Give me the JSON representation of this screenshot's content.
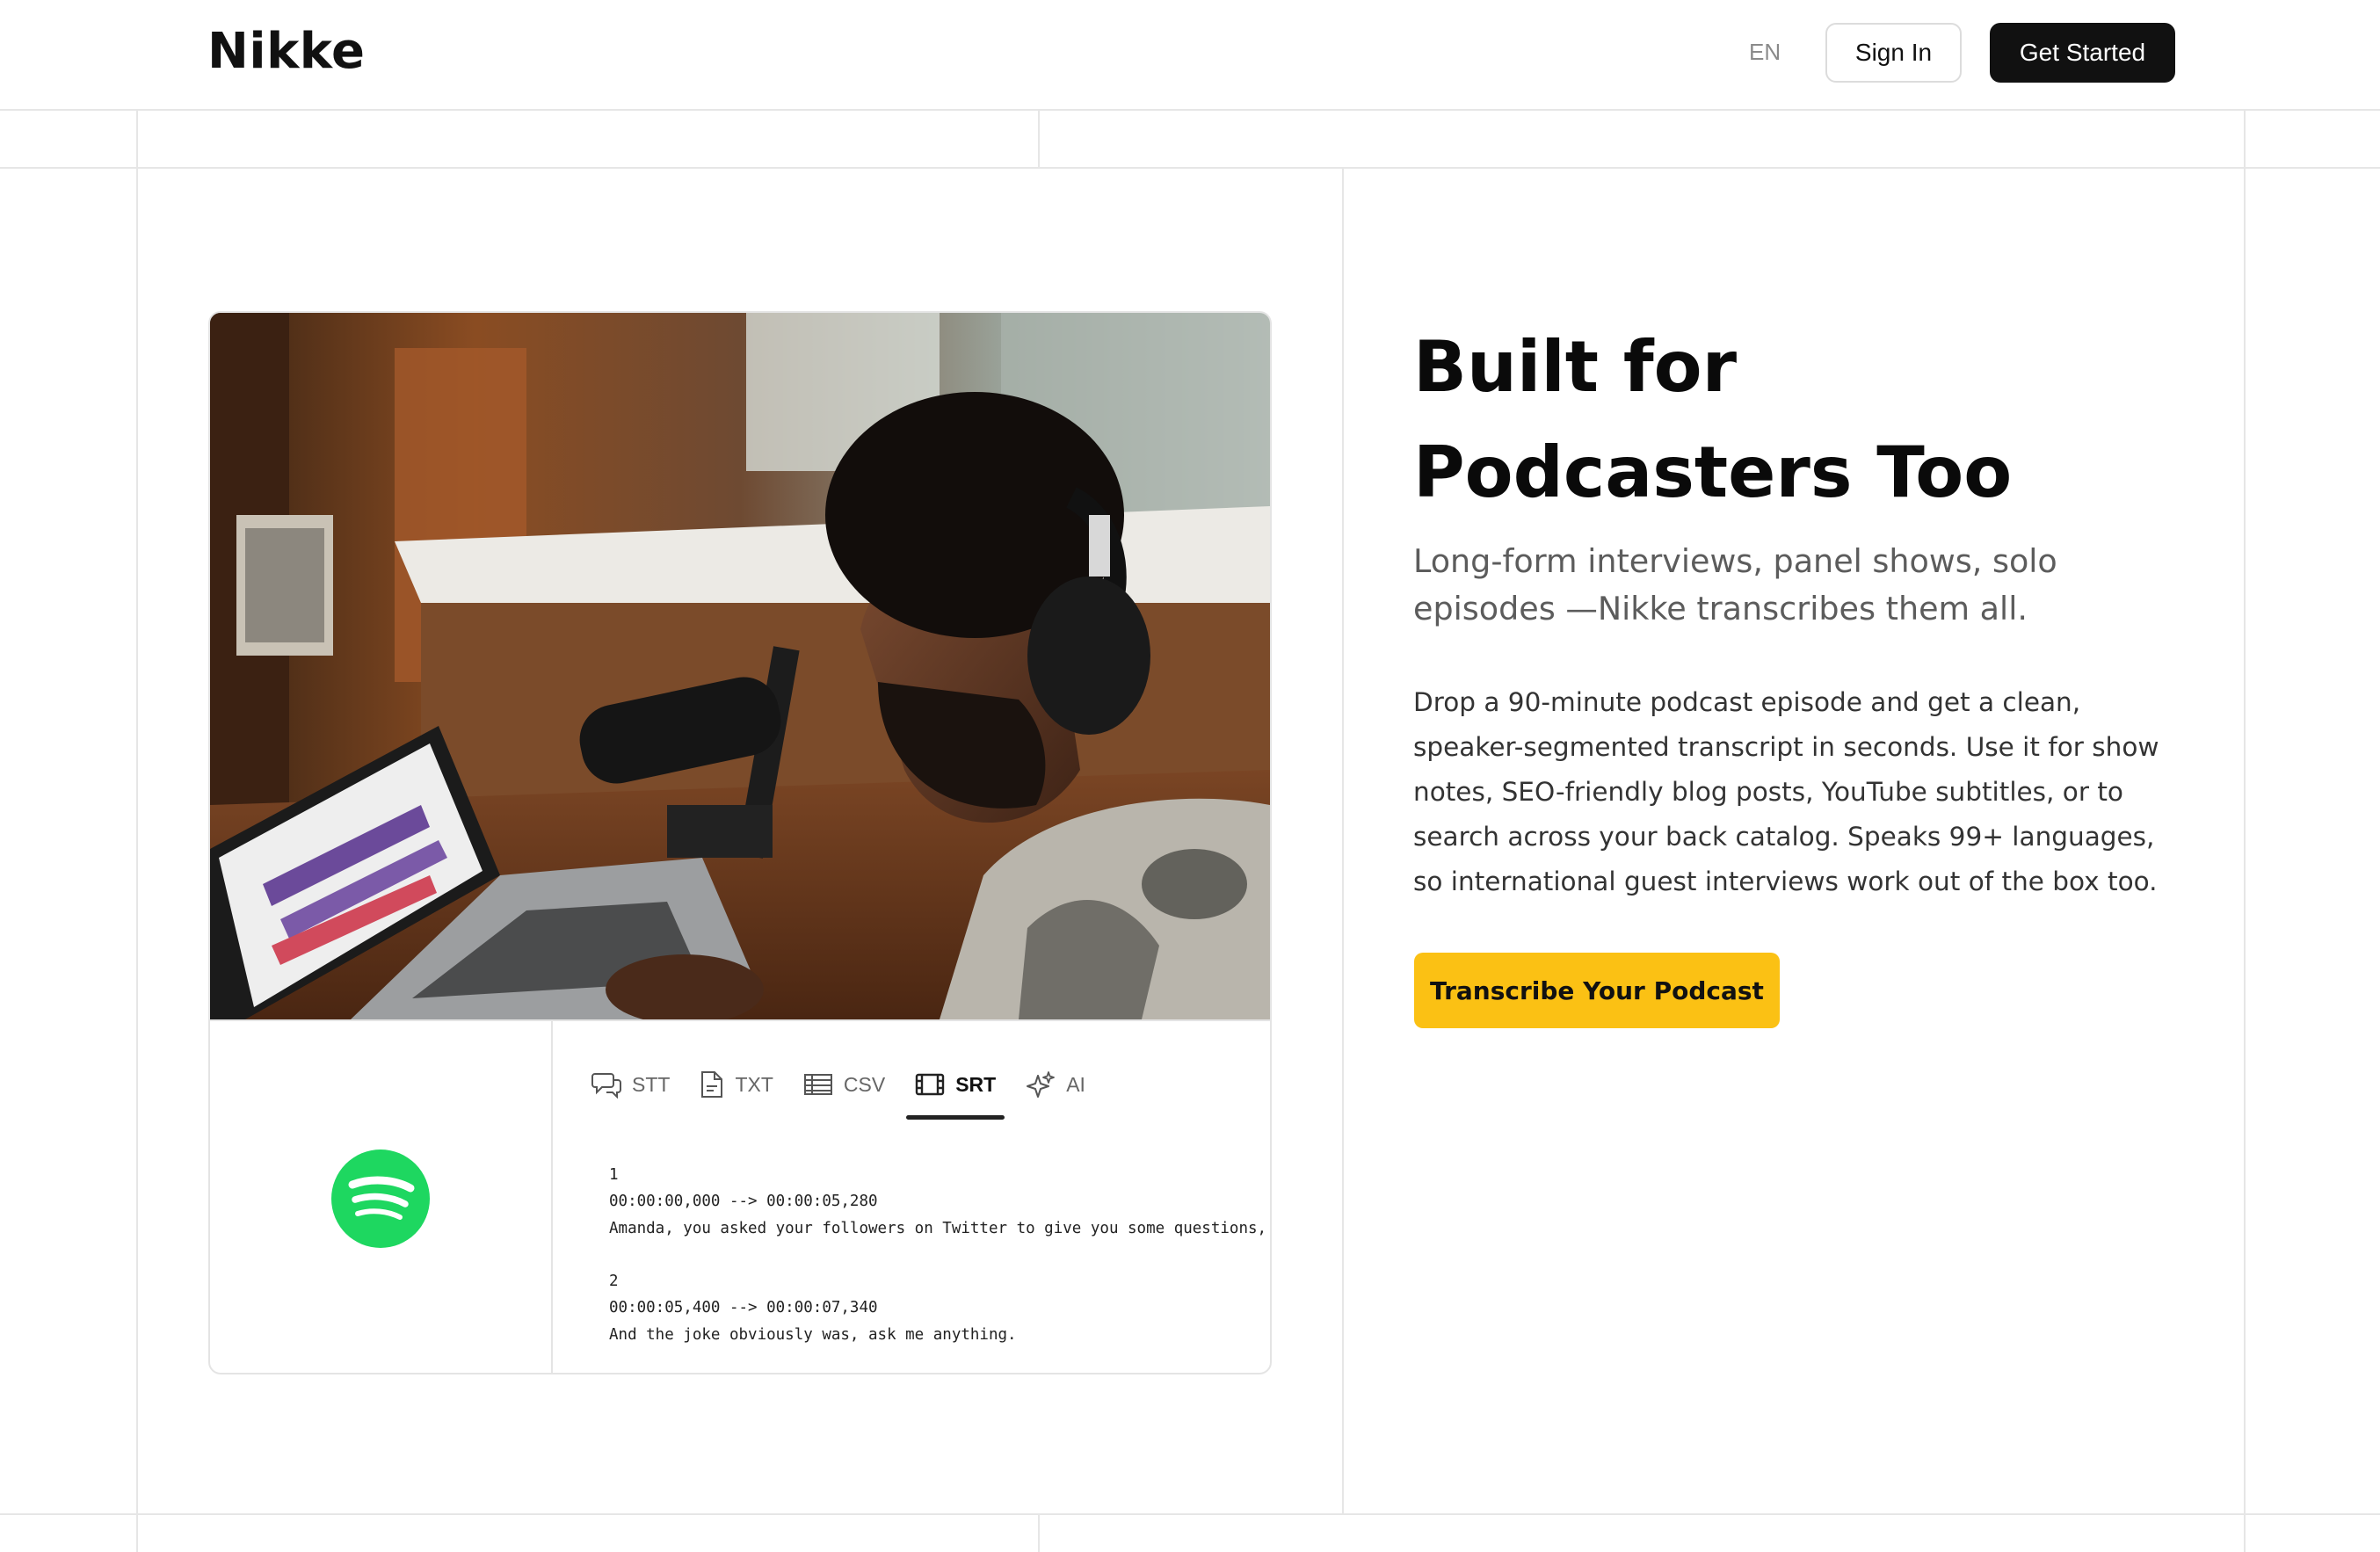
{
  "header": {
    "logo": "Nikke",
    "lang": "EN",
    "sign_in": "Sign In",
    "get_started": "Get Started"
  },
  "card": {
    "tabs": [
      {
        "label": "STT",
        "icon": "speech-bubbles-icon"
      },
      {
        "label": "TXT",
        "icon": "document-icon"
      },
      {
        "label": "CSV",
        "icon": "table-icon"
      },
      {
        "label": "SRT",
        "icon": "film-icon",
        "active": true
      },
      {
        "label": "AI",
        "icon": "sparkles-icon"
      }
    ],
    "srt_lines": [
      "1",
      "00:00:00,000 --> 00:00:05,280",
      "Amanda, you asked your followers on Twitter to give you some questions, to",
      "",
      "2",
      "00:00:05,400 --> 00:00:07,340",
      "And the joke obviously was, ask me anything."
    ],
    "brand_logo": "spotify-logo",
    "brand_color": "#1ed760"
  },
  "hero": {
    "headline_line1": "Built for",
    "headline_line2": "Podcasters Too",
    "subhead": "Long-form interviews, panel shows, solo episodes —Nikke transcribes them all.",
    "body": "Drop a 90-minute podcast episode and get a clean, speaker-segmented transcript in seconds. Use it for show notes, SEO-friendly blog posts, YouTube subtitles, or to search across your back catalog. Speaks 99+ languages, so international guest interviews work out of the box too.",
    "cta": "Transcribe Your Podcast",
    "cta_color": "#fbc114"
  }
}
